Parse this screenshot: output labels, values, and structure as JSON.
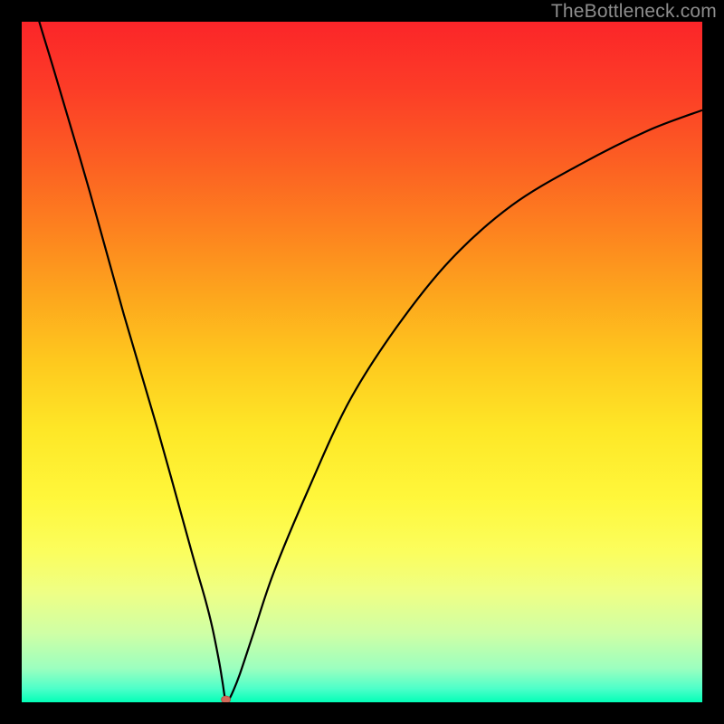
{
  "watermark": "TheBottleneck.com",
  "chart_data": {
    "type": "line",
    "title": "",
    "xlabel": "",
    "ylabel": "",
    "xlim": [
      0,
      100
    ],
    "ylim": [
      0,
      100
    ],
    "grid": false,
    "legend": false,
    "series": [
      {
        "name": "bottleneck-curve",
        "x": [
          0,
          2,
          5,
          10,
          15,
          20,
          25,
          27,
          28,
          29,
          29.5,
          30,
          30.5,
          31,
          32,
          34,
          37,
          42,
          48,
          55,
          63,
          72,
          82,
          92,
          100
        ],
        "y": [
          110,
          102,
          92,
          75,
          57,
          40,
          22,
          15,
          11,
          6,
          3,
          0,
          0.5,
          1.5,
          4,
          10,
          19,
          31,
          44,
          55,
          65,
          73,
          79,
          84,
          87
        ]
      }
    ],
    "marker": {
      "name": "optimal-point",
      "x": 30,
      "y": 0,
      "color": "#d26a59",
      "rx": 5,
      "ry": 4
    },
    "curve_color": "#000000",
    "curve_width": 2.2
  }
}
